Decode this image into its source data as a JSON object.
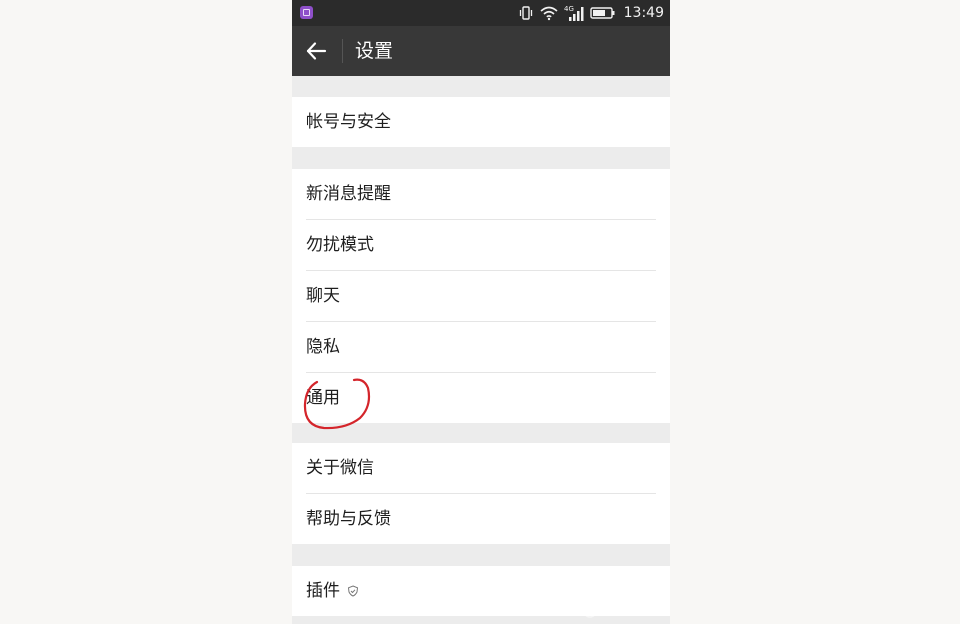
{
  "status_bar": {
    "network_label": "4G",
    "time": "13:49"
  },
  "header": {
    "title": "设置"
  },
  "sections": [
    {
      "items": [
        {
          "label": "帐号与安全"
        }
      ]
    },
    {
      "items": [
        {
          "label": "新消息提醒"
        },
        {
          "label": "勿扰模式"
        },
        {
          "label": "聊天"
        },
        {
          "label": "隐私"
        },
        {
          "label": "通用"
        }
      ]
    },
    {
      "items": [
        {
          "label": "关于微信"
        },
        {
          "label": "帮助与反馈"
        }
      ]
    },
    {
      "items": [
        {
          "label": "插件"
        }
      ]
    }
  ],
  "colors": {
    "status_bar": "#2b2b2b",
    "action_bar": "#383838",
    "section_gap": "#ececec",
    "annotation": "#d4252b"
  },
  "icons": {
    "back": "arrow-left-icon",
    "plugin": "shield-outline-icon"
  }
}
